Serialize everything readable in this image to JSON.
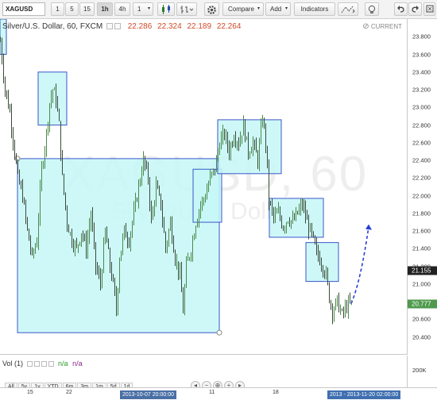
{
  "toolbar": {
    "symbol": "XAGUSD",
    "intervals": [
      "1",
      "5",
      "15",
      "1h",
      "4h"
    ],
    "active_interval": "1h",
    "interval_dropdown": "1",
    "compare_label": "Compare",
    "add_label": "Add",
    "indicators_label": "Indicators"
  },
  "legend": {
    "title": "Silver/U.S. Dollar, 60, FXCM",
    "open": "22.286",
    "high": "22.324",
    "low": "22.189",
    "close": "22.264"
  },
  "watermark": {
    "symbol": "XAGUSD, 60",
    "name": "Silver/U.S. Dollar"
  },
  "settings_tag": "CURRENT",
  "price_axis": {
    "ticks": [
      "23.800",
      "23.600",
      "23.400",
      "23.200",
      "23.000",
      "22.800",
      "22.600",
      "22.400",
      "22.200",
      "22.000",
      "21.800",
      "21.600",
      "21.400",
      "21.200",
      "21.000",
      "20.800",
      "20.600",
      "20.400"
    ],
    "badge_black": "21.155",
    "badge_green": "20.777",
    "colors": {
      "badge_black": "#222222",
      "badge_green": "#4f9a4f"
    }
  },
  "volume": {
    "label": "Vol (1)",
    "value1": "n/a",
    "value2": "n/a",
    "tick": "200K"
  },
  "timeframes": [
    "All",
    "5y",
    "1y",
    "YTD",
    "6m",
    "3m",
    "1m",
    "5d",
    "1d"
  ],
  "time_axis": {
    "labels": [
      "15",
      "22",
      "11",
      "18"
    ],
    "badge_left": "2013-10-07 20:00:00",
    "badge_right": "2013 - 2013-11-20 02:00:00"
  },
  "colors": {
    "box_fill": "#c6f7f7",
    "box_stroke": "#3a57c8",
    "candles": "#3f6b3f",
    "forecast": "#2a3fd6",
    "legend_values": "#d24b2a"
  },
  "chart_data": {
    "type": "candlestick",
    "title": "Silver/U.S. Dollar, 60, FXCM",
    "ylim": [
      20.2,
      24.0
    ],
    "price_path": [
      [
        0,
        23.75
      ],
      [
        6,
        23.2
      ],
      [
        12,
        22.95
      ],
      [
        18,
        22.5
      ],
      [
        22,
        22.2
      ],
      [
        28,
        22.0
      ],
      [
        34,
        21.6
      ],
      [
        40,
        21.3
      ],
      [
        46,
        21.5
      ],
      [
        52,
        22.3
      ],
      [
        58,
        22.7
      ],
      [
        62,
        23.05
      ],
      [
        66,
        23.2
      ],
      [
        70,
        23.1
      ],
      [
        74,
        22.8
      ],
      [
        78,
        22.2
      ],
      [
        84,
        21.7
      ],
      [
        90,
        21.5
      ],
      [
        96,
        21.4
      ],
      [
        102,
        21.6
      ],
      [
        108,
        21.4
      ],
      [
        114,
        21.8
      ],
      [
        120,
        21.2
      ],
      [
        126,
        21.0
      ],
      [
        132,
        21.6
      ],
      [
        138,
        21.2
      ],
      [
        142,
        21.0
      ],
      [
        146,
        20.7
      ],
      [
        150,
        21.3
      ],
      [
        156,
        21.6
      ],
      [
        162,
        21.5
      ],
      [
        168,
        21.8
      ],
      [
        174,
        22.1
      ],
      [
        180,
        22.4
      ],
      [
        186,
        22.2
      ],
      [
        190,
        21.7
      ],
      [
        196,
        22.1
      ],
      [
        202,
        21.9
      ],
      [
        208,
        21.4
      ],
      [
        214,
        21.7
      ],
      [
        220,
        21.3
      ],
      [
        226,
        21.1
      ],
      [
        230,
        20.7
      ],
      [
        234,
        21.2
      ],
      [
        240,
        21.4
      ],
      [
        246,
        21.7
      ],
      [
        252,
        21.9
      ],
      [
        258,
        22.0
      ],
      [
        264,
        22.2
      ],
      [
        270,
        22.3
      ],
      [
        276,
        22.6
      ],
      [
        282,
        22.7
      ],
      [
        288,
        22.5
      ],
      [
        294,
        22.7
      ],
      [
        300,
        22.6
      ],
      [
        306,
        22.8
      ],
      [
        312,
        22.5
      ],
      [
        318,
        22.6
      ],
      [
        324,
        22.4
      ],
      [
        330,
        22.9
      ],
      [
        334,
        22.6
      ],
      [
        338,
        21.95
      ],
      [
        344,
        21.75
      ],
      [
        350,
        21.8
      ],
      [
        356,
        21.65
      ],
      [
        362,
        21.75
      ],
      [
        368,
        21.7
      ],
      [
        374,
        21.8
      ],
      [
        380,
        21.9
      ],
      [
        386,
        21.7
      ],
      [
        392,
        21.55
      ],
      [
        398,
        21.35
      ],
      [
        404,
        21.25
      ],
      [
        410,
        21.1
      ],
      [
        414,
        20.85
      ],
      [
        418,
        20.7
      ],
      [
        424,
        20.8
      ],
      [
        430,
        20.65
      ],
      [
        436,
        20.75
      ],
      [
        442,
        20.78
      ]
    ],
    "forecast": {
      "from": [
        442,
        20.78
      ],
      "to": [
        464,
        21.65
      ]
    },
    "boxes": [
      {
        "x0": 0,
        "x1": 8,
        "y_top": 24.0,
        "y_bottom": 23.6
      },
      {
        "x0": 48,
        "x1": 84,
        "y_top": 23.4,
        "y_bottom": 22.8
      },
      {
        "x0": 22,
        "x1": 276,
        "y_top": 22.42,
        "y_bottom": 20.45
      },
      {
        "x0": 243,
        "x1": 279,
        "y_top": 22.3,
        "y_bottom": 21.7
      },
      {
        "x0": 274,
        "x1": 354,
        "y_top": 22.86,
        "y_bottom": 22.25
      },
      {
        "x0": 339,
        "x1": 407,
        "y_top": 21.97,
        "y_bottom": 21.53
      },
      {
        "x0": 385,
        "x1": 426,
        "y_top": 21.47,
        "y_bottom": 21.03
      }
    ]
  }
}
